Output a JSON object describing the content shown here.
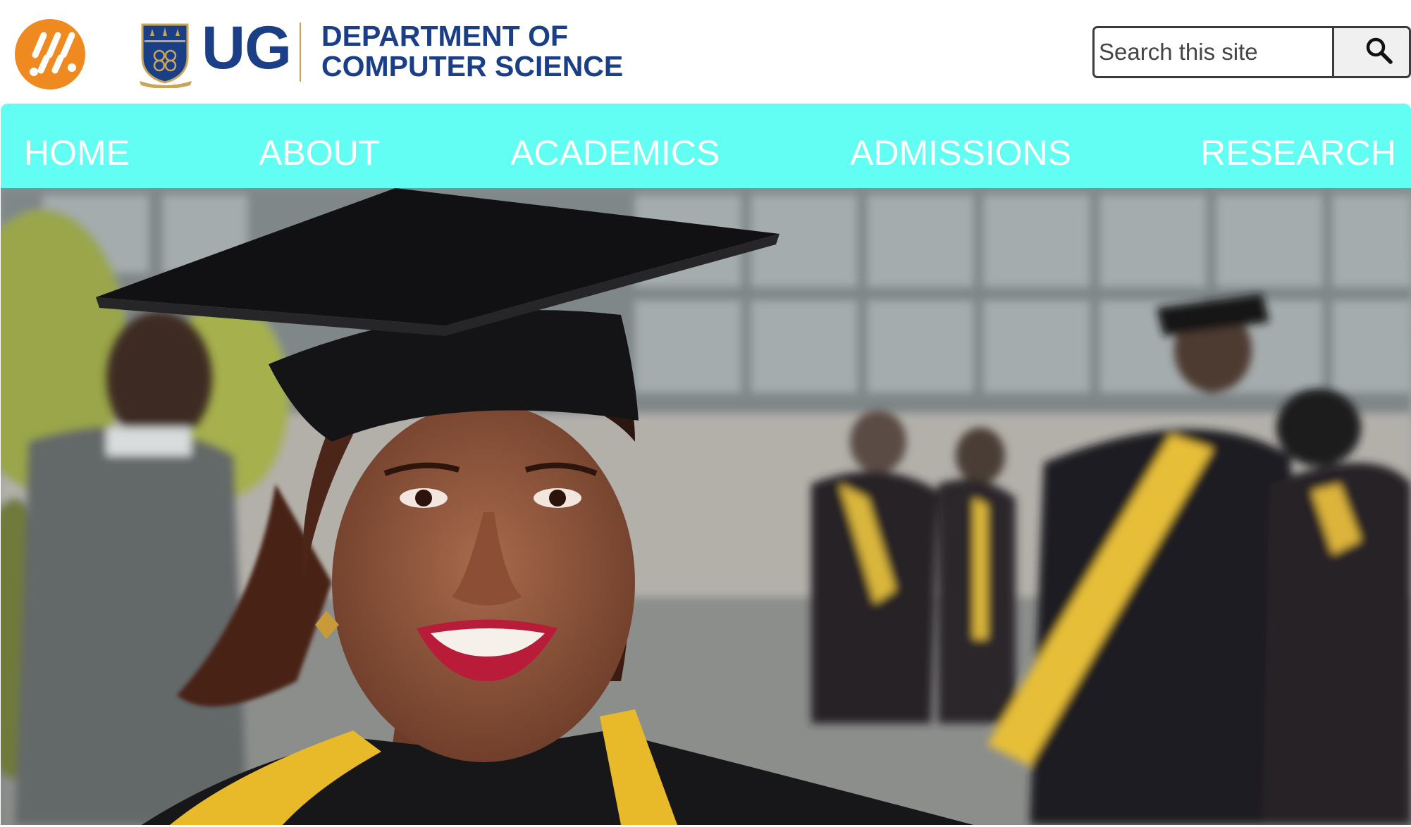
{
  "header": {
    "brand_ug": "UG",
    "department_line1": "DEPARTMENT OF",
    "department_line2": "COMPUTER SCIENCE",
    "logo_icon": "app-logo-icon",
    "crest_icon": "university-crest-icon"
  },
  "search": {
    "placeholder": "Search this site",
    "value": "",
    "button_icon": "search-icon"
  },
  "nav": {
    "items": [
      {
        "label": "HOME"
      },
      {
        "label": "ABOUT"
      },
      {
        "label": "ACADEMICS"
      },
      {
        "label": "ADMISSIONS"
      },
      {
        "label": "RESEARCH"
      }
    ]
  },
  "hero": {
    "image": "graduation-photo"
  },
  "colors": {
    "brand_blue": "#1b3f86",
    "nav_bg": "#62fdf3",
    "logo_orange": "#ee8a1f",
    "gold": "#c9a55a"
  }
}
